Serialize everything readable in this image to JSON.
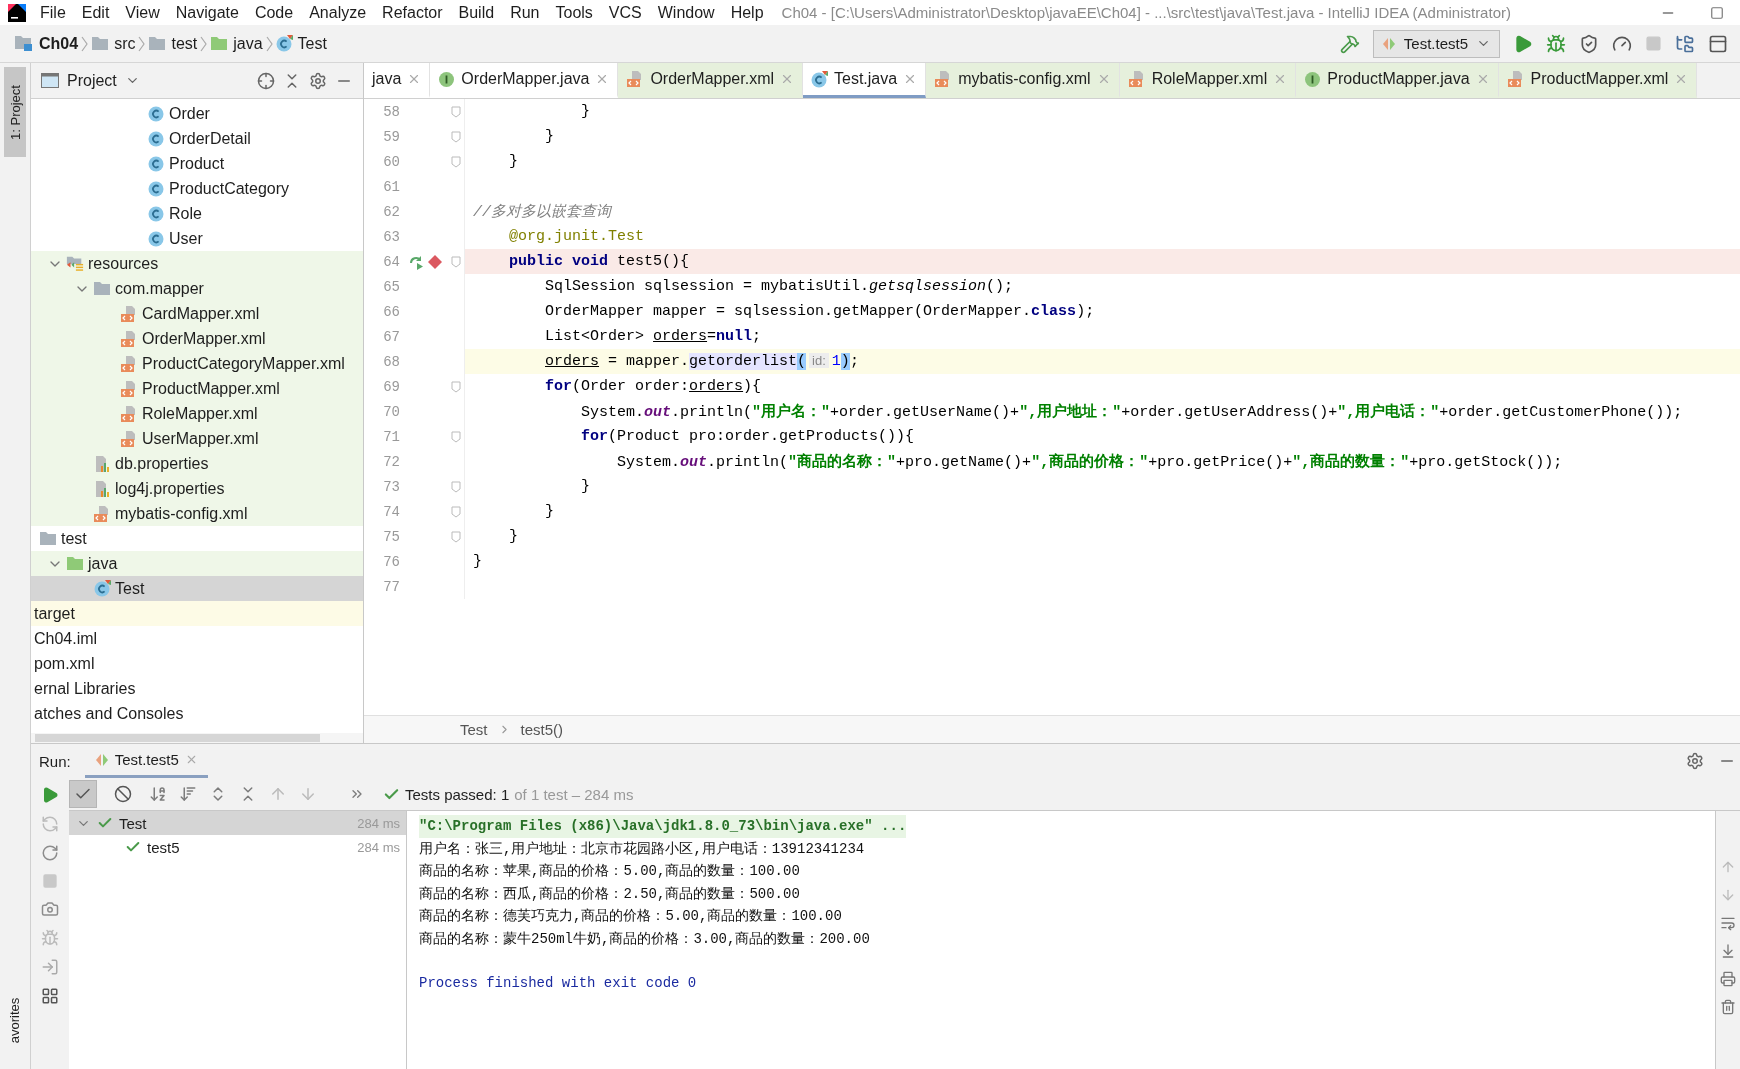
{
  "menu_bar": {
    "items": [
      "File",
      "Edit",
      "View",
      "Navigate",
      "Code",
      "Analyze",
      "Refactor",
      "Build",
      "Run",
      "Tools",
      "VCS",
      "Window",
      "Help"
    ],
    "title": "Ch04 - [C:\\Users\\Administrator\\Desktop\\javaEE\\Ch04] - ...\\src\\test\\java\\Test.java - IntelliJ IDEA (Administrator)"
  },
  "nav_bar": {
    "crumbs": [
      {
        "label": "Ch04",
        "kind": "module"
      },
      {
        "label": "src",
        "kind": "folder"
      },
      {
        "label": "test",
        "kind": "folder"
      },
      {
        "label": "java",
        "kind": "test-folder"
      },
      {
        "label": "Test",
        "kind": "test-class"
      }
    ],
    "run_config": "Test.test5"
  },
  "left_stripe": {
    "tabs": [
      "1: Project",
      "avorites"
    ]
  },
  "project": {
    "title": "Project",
    "upper_rows": [
      {
        "label": "Order",
        "kind": "class",
        "selected": false
      },
      {
        "label": "OrderDetail",
        "kind": "class",
        "selected": false
      },
      {
        "label": "Product",
        "kind": "class",
        "selected": false
      },
      {
        "label": "ProductCategory",
        "kind": "class",
        "selected": false
      },
      {
        "label": "Role",
        "kind": "class",
        "selected": false
      },
      {
        "label": "User",
        "kind": "class",
        "selected": false
      }
    ],
    "tree": [
      {
        "label": "resources",
        "kind": "resources-folder",
        "expanded": true,
        "selected": false,
        "color": "#eff7e8",
        "children": [
          {
            "label": "com.mapper",
            "kind": "folder",
            "expanded": true,
            "selected": false,
            "color": "#eff7e8",
            "children": [
              {
                "label": "CardMapper.xml",
                "kind": "xml",
                "selected": false,
                "color": "#eff7e8"
              },
              {
                "label": "OrderMapper.xml",
                "kind": "xml",
                "selected": false,
                "color": "#eff7e8"
              },
              {
                "label": "ProductCategoryMapper.xml",
                "kind": "xml",
                "selected": false,
                "color": "#eff7e8"
              },
              {
                "label": "ProductMapper.xml",
                "kind": "xml",
                "selected": false,
                "color": "#eff7e8"
              },
              {
                "label": "RoleMapper.xml",
                "kind": "xml",
                "selected": false,
                "color": "#eff7e8"
              },
              {
                "label": "UserMapper.xml",
                "kind": "xml",
                "selected": false,
                "color": "#eff7e8"
              }
            ]
          },
          {
            "label": "db.properties",
            "kind": "properties",
            "selected": false,
            "color": "#eff7e8"
          },
          {
            "label": "log4j.properties",
            "kind": "properties",
            "selected": false,
            "color": "#eff7e8"
          },
          {
            "label": "mybatis-config.xml",
            "kind": "xml",
            "selected": false,
            "color": "#eff7e8"
          }
        ]
      }
    ],
    "test_tree": [
      {
        "label": "test",
        "kind": "folder",
        "selected": false,
        "children": [
          {
            "label": "java",
            "kind": "test-folder",
            "expanded": true,
            "selected": false,
            "color": "#eff7e8",
            "children": [
              {
                "label": "Test",
                "kind": "test-class",
                "selected": true
              }
            ]
          }
        ]
      }
    ],
    "outer_rows": [
      {
        "label": "target",
        "selected": false,
        "color": "#fdfbe6"
      },
      {
        "label": "Ch04.iml",
        "selected": false
      },
      {
        "label": "pom.xml",
        "selected": false
      },
      {
        "label": "ernal Libraries",
        "selected": false
      },
      {
        "label": "atches and Consoles",
        "selected": false
      }
    ]
  },
  "editor": {
    "tabs": [
      {
        "label": "java",
        "kind": "clipped",
        "selected": false,
        "color": "#ffffff"
      },
      {
        "label": "OrderMapper.java",
        "kind": "interface",
        "selected": false,
        "color": "#ffffff"
      },
      {
        "label": "OrderMapper.xml",
        "kind": "xml",
        "selected": false,
        "color": "#e6f0dc"
      },
      {
        "label": "Test.java",
        "kind": "test-class",
        "selected": true,
        "color": "#ffffff"
      },
      {
        "label": "mybatis-config.xml",
        "kind": "xml",
        "selected": false,
        "color": "#e6f0dc"
      },
      {
        "label": "RoleMapper.xml",
        "kind": "xml",
        "selected": false,
        "color": "#e6f0dc"
      },
      {
        "label": "ProductMapper.java",
        "kind": "interface",
        "selected": false,
        "color": "#e6f0dc"
      },
      {
        "label": "ProductMapper.xml",
        "kind": "xml",
        "selected": false,
        "color": "#e6f0dc"
      }
    ],
    "lines": [
      {
        "number": "58",
        "kind": "normal",
        "fold": true,
        "tokens": [
          {
            "kind": "plain",
            "text": "            }"
          }
        ]
      },
      {
        "number": "59",
        "kind": "normal",
        "fold": true,
        "tokens": [
          {
            "kind": "plain",
            "text": "        }"
          }
        ]
      },
      {
        "number": "60",
        "kind": "normal",
        "fold": true,
        "tokens": [
          {
            "kind": "plain",
            "text": "    }"
          }
        ]
      },
      {
        "number": "61",
        "kind": "normal",
        "fold": false
      },
      {
        "number": "62",
        "kind": "normal",
        "fold": false,
        "tokens": [
          {
            "kind": "comment",
            "text": "//多对多以嵌套查询"
          }
        ]
      },
      {
        "number": "63",
        "kind": "normal",
        "fold": false,
        "tokens": [
          {
            "kind": "annotation",
            "text": "    @org.junit.Test"
          }
        ]
      },
      {
        "number": "64",
        "kind": "breakpoint",
        "fold": true,
        "tokens": [
          {
            "kind": "keyword",
            "text": "    public void "
          },
          {
            "kind": "plain",
            "text": "test5(){"
          }
        ]
      },
      {
        "number": "65",
        "kind": "normal",
        "fold": false,
        "tokens": [
          {
            "kind": "plain",
            "text": "        SqlSession sqlsession = mybatisUtil."
          },
          {
            "kind": "static",
            "text": "getsqlsession"
          },
          {
            "kind": "plain",
            "text": "();"
          }
        ]
      },
      {
        "number": "66",
        "kind": "normal",
        "fold": false,
        "tokens": [
          {
            "kind": "plain",
            "text": "        OrderMapper mapper = sqlsession.getMapper(OrderMapper."
          },
          {
            "kind": "keyword",
            "text": "class"
          },
          {
            "kind": "plain",
            "text": ");"
          }
        ]
      },
      {
        "number": "67",
        "kind": "normal",
        "fold": false,
        "tokens": [
          {
            "kind": "plain",
            "text": "        List<Order> "
          },
          {
            "kind": "var",
            "text": "orders"
          },
          {
            "kind": "plain",
            "text": "="
          },
          {
            "kind": "keyword",
            "text": "null"
          },
          {
            "kind": "plain",
            "text": ";"
          }
        ]
      },
      {
        "number": "68",
        "kind": "current",
        "fold": false,
        "tokens": [
          {
            "kind": "var",
            "text": "        orders"
          },
          {
            "kind": "plain",
            "text": " = mapper."
          },
          {
            "kind": "usage",
            "text": "getorderlist"
          },
          {
            "kind": "brace",
            "text": "("
          },
          {
            "kind": "hint",
            "text": "id:"
          },
          {
            "kind": "number",
            "text": "1"
          },
          {
            "kind": "brace",
            "text": ")"
          },
          {
            "kind": "plain",
            "text": ";"
          }
        ]
      },
      {
        "number": "69",
        "kind": "normal",
        "fold": true,
        "tokens": [
          {
            "kind": "keyword",
            "text": "        for"
          },
          {
            "kind": "plain",
            "text": "(Order order:"
          },
          {
            "kind": "var",
            "text": "orders"
          },
          {
            "kind": "plain",
            "text": "){"
          }
        ]
      },
      {
        "number": "70",
        "kind": "normal",
        "fold": false,
        "tokens": [
          {
            "kind": "plain",
            "text": "            System."
          },
          {
            "kind": "field",
            "text": "out"
          },
          {
            "kind": "plain",
            "text": ".println("
          },
          {
            "kind": "string",
            "text": "\"用户名：\""
          },
          {
            "kind": "plain",
            "text": "+order.getUserName()+"
          },
          {
            "kind": "string",
            "text": "\",用户地址：\""
          },
          {
            "kind": "plain",
            "text": "+order.getUserAddress()+"
          },
          {
            "kind": "string",
            "text": "\",用户电话：\""
          },
          {
            "kind": "plain",
            "text": "+order.getCustomerPhone());"
          }
        ]
      },
      {
        "number": "71",
        "kind": "normal",
        "fold": true,
        "tokens": [
          {
            "kind": "keyword",
            "text": "            for"
          },
          {
            "kind": "plain",
            "text": "(Product pro:order.getProducts()){"
          }
        ]
      },
      {
        "number": "72",
        "kind": "normal",
        "fold": false,
        "tokens": [
          {
            "kind": "plain",
            "text": "                System."
          },
          {
            "kind": "field",
            "text": "out"
          },
          {
            "kind": "plain",
            "text": ".println("
          },
          {
            "kind": "string",
            "text": "\"商品的名称：\""
          },
          {
            "kind": "plain",
            "text": "+pro.getName()+"
          },
          {
            "kind": "string",
            "text": "\",商品的价格：\""
          },
          {
            "kind": "plain",
            "text": "+pro.getPrice()+"
          },
          {
            "kind": "string",
            "text": "\",商品的数量：\""
          },
          {
            "kind": "plain",
            "text": "+pro.getStock());"
          }
        ]
      },
      {
        "number": "73",
        "kind": "normal",
        "fold": true,
        "tokens": [
          {
            "kind": "plain",
            "text": "            }"
          }
        ]
      },
      {
        "number": "74",
        "kind": "normal",
        "fold": true,
        "tokens": [
          {
            "kind": "plain",
            "text": "        }"
          }
        ]
      },
      {
        "number": "75",
        "kind": "normal",
        "fold": true,
        "tokens": [
          {
            "kind": "plain",
            "text": "    }"
          }
        ]
      },
      {
        "number": "76",
        "kind": "normal",
        "fold": false,
        "tokens": [
          {
            "kind": "plain",
            "text": "}"
          }
        ]
      },
      {
        "number": "77",
        "kind": "normal",
        "fold": false
      }
    ],
    "breadcrumb": [
      "Test",
      "test5()"
    ]
  },
  "run": {
    "label": "Run:",
    "tab": "Test.test5",
    "toolbar": [
      {
        "kind": "show-passed",
        "on": true
      },
      {
        "kind": "show-ignored",
        "on": false
      }
    ],
    "status": "Tests passed: 1",
    "status_detail": "of 1 test – 284 ms",
    "tests": [
      {
        "label": "Test",
        "time": "284 ms",
        "passed": true,
        "expanded": true,
        "selected": true,
        "children": [
          {
            "label": "test5",
            "time": "284 ms",
            "passed": true,
            "selected": false
          }
        ]
      }
    ],
    "console": [
      {
        "kind": "command",
        "text": "\"C:\\Program Files (x86)\\Java\\jdk1.8.0_73\\bin\\java.exe\" ..."
      },
      {
        "kind": "output",
        "text": "用户名：张三,用户地址：北京市花园路小区,用户电话：13912341234"
      },
      {
        "kind": "output",
        "text": "商品的名称：苹果,商品的价格：5.00,商品的数量：100.00"
      },
      {
        "kind": "output",
        "text": "商品的名称：西瓜,商品的价格：2.50,商品的数量：500.00"
      },
      {
        "kind": "output",
        "text": "商品的名称：德芙巧克力,商品的价格：5.00,商品的数量：100.00"
      },
      {
        "kind": "output",
        "text": "商品的名称：蒙牛250ml牛奶,商品的价格：3.00,商品的数量：200.00"
      },
      {
        "kind": "exit",
        "text": "Process finished with exit code 0"
      }
    ]
  }
}
